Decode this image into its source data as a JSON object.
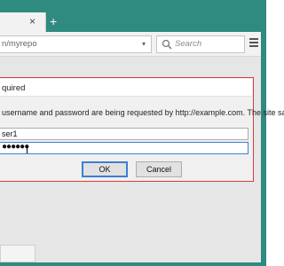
{
  "browser": {
    "tab_close_glyph": "×",
    "new_tab_glyph": "+",
    "url": "n/myrepo",
    "url_dropdown_glyph": "▾",
    "search_placeholder": "Search"
  },
  "dialog": {
    "title": "quired",
    "message": "username and password are being requested by http://example.com. The site sa",
    "username_value": "ser1",
    "password_mask": "●●●●●●",
    "ok_label": "OK",
    "cancel_label": "Cancel"
  },
  "colors": {
    "frame": "#2f8a80",
    "dialog_border": "#d83c3c",
    "focus": "#3c7fd3"
  }
}
